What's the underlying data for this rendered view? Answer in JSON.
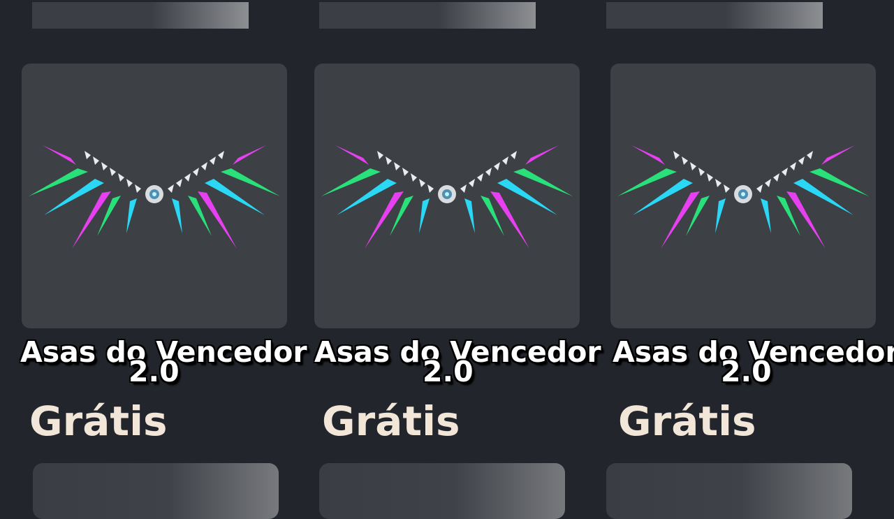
{
  "items": [
    {
      "name_line1": "Asas do Vencedor",
      "name_line2": "2.0",
      "price": "Grátis"
    },
    {
      "name_line1": "Asas do Vencedor",
      "name_line2": "2.0",
      "price": "Grátis"
    },
    {
      "name_line1": "Asas do Vencedor",
      "name_line2": "2.0",
      "price": "Grátis"
    }
  ],
  "colors": {
    "background": "#22252b",
    "card": "#3d4045",
    "price_text": "#f1e6d7",
    "wing_magenta": "#e640f0",
    "wing_green": "#29e07a",
    "wing_cyan": "#2ad8f5"
  },
  "icons": [
    "winners-wings-icon"
  ]
}
